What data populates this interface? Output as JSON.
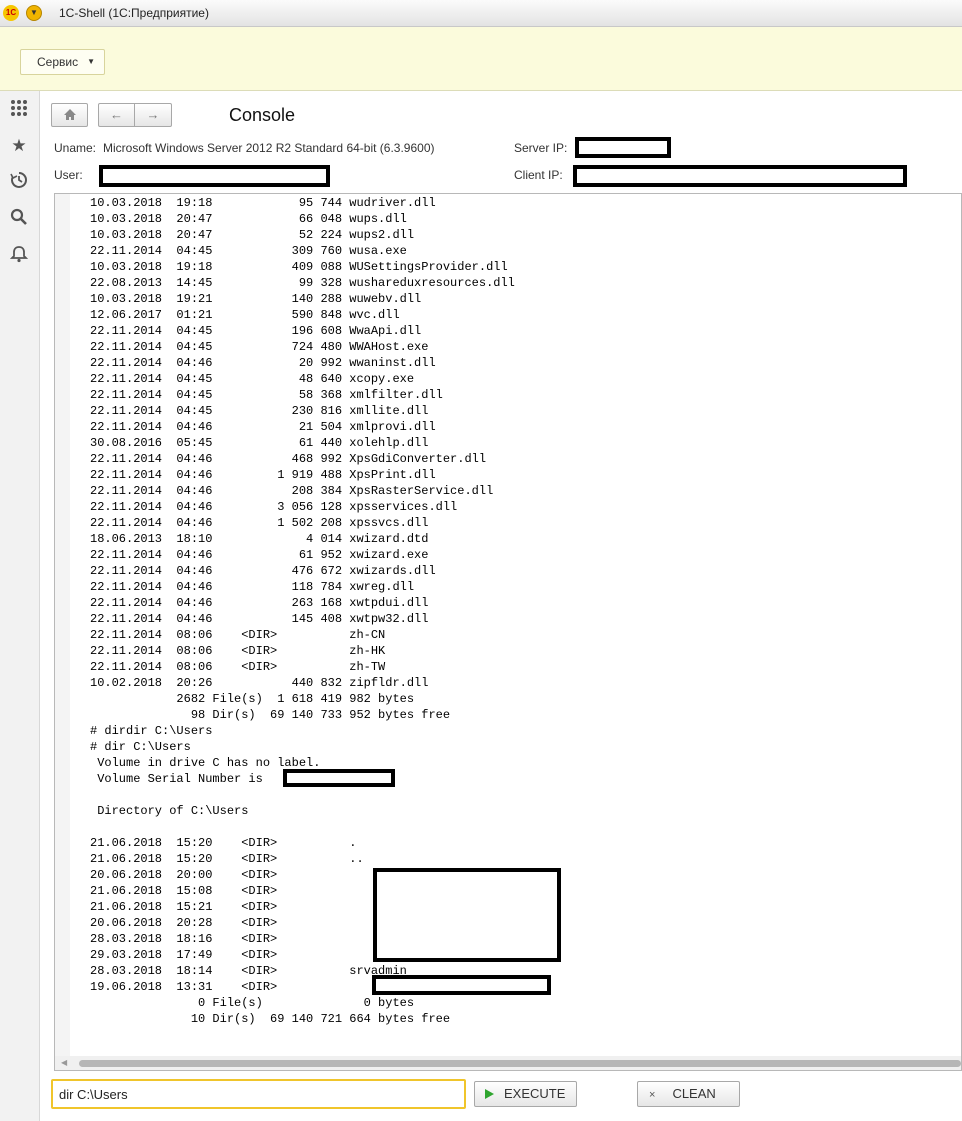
{
  "window": {
    "title": "1C-Shell  (1С:Предприятие)",
    "logo": "1С"
  },
  "section": {
    "service_button": "Сервис"
  },
  "sidebar": {
    "icons": [
      "apps-grid-icon",
      "star-icon",
      "history-icon",
      "search-icon",
      "bell-icon"
    ]
  },
  "header": {
    "title": "Console",
    "uname_label": "Uname:",
    "uname_value": "Microsoft Windows Server 2012 R2 Standard 64-bit (6.3.9600)",
    "user_label": "User:",
    "server_ip_label": "Server IP:",
    "client_ip_label": "Client IP:"
  },
  "console": {
    "lines": [
      "10.03.2018  19:18            95 744 wudriver.dll",
      "10.03.2018  20:47            66 048 wups.dll",
      "10.03.2018  20:47            52 224 wups2.dll",
      "22.11.2014  04:45           309 760 wusa.exe",
      "10.03.2018  19:18           409 088 WUSettingsProvider.dll",
      "22.08.2013  14:45            99 328 wushareduxresources.dll",
      "10.03.2018  19:21           140 288 wuwebv.dll",
      "12.06.2017  01:21           590 848 wvc.dll",
      "22.11.2014  04:45           196 608 WwaApi.dll",
      "22.11.2014  04:45           724 480 WWAHost.exe",
      "22.11.2014  04:46            20 992 wwaninst.dll",
      "22.11.2014  04:45            48 640 xcopy.exe",
      "22.11.2014  04:45            58 368 xmlfilter.dll",
      "22.11.2014  04:45           230 816 xmllite.dll",
      "22.11.2014  04:46            21 504 xmlprovi.dll",
      "30.08.2016  05:45            61 440 xolehlp.dll",
      "22.11.2014  04:46           468 992 XpsGdiConverter.dll",
      "22.11.2014  04:46         1 919 488 XpsPrint.dll",
      "22.11.2014  04:46           208 384 XpsRasterService.dll",
      "22.11.2014  04:46         3 056 128 xpsservices.dll",
      "22.11.2014  04:46         1 502 208 xpssvcs.dll",
      "18.06.2013  18:10             4 014 xwizard.dtd",
      "22.11.2014  04:46            61 952 xwizard.exe",
      "22.11.2014  04:46           476 672 xwizards.dll",
      "22.11.2014  04:46           118 784 xwreg.dll",
      "22.11.2014  04:46           263 168 xwtpdui.dll",
      "22.11.2014  04:46           145 408 xwtpw32.dll",
      "22.11.2014  08:06    <DIR>          zh-CN",
      "22.11.2014  08:06    <DIR>          zh-HK",
      "22.11.2014  08:06    <DIR>          zh-TW",
      "10.02.2018  20:26           440 832 zipfldr.dll",
      "            2682 File(s)  1 618 419 982 bytes",
      "              98 Dir(s)  69 140 733 952 bytes free",
      "# dirdir C:\\Users",
      "# dir C:\\Users",
      " Volume in drive C has no label.",
      " Volume Serial Number is",
      "",
      " Directory of C:\\Users",
      "",
      "21.06.2018  15:20    <DIR>          .",
      "21.06.2018  15:20    <DIR>          ..",
      "20.06.2018  20:00    <DIR>",
      "21.06.2018  15:08    <DIR>",
      "21.06.2018  15:21    <DIR>",
      "20.06.2018  20:28    <DIR>",
      "28.03.2018  18:16    <DIR>",
      "29.03.2018  17:49    <DIR>",
      "28.03.2018  18:14    <DIR>          srvadmin",
      "19.06.2018  13:31    <DIR>",
      "               0 File(s)              0 bytes",
      "              10 Dir(s)  69 140 721 664 bytes free"
    ]
  },
  "command": {
    "value": "dir C:\\Users"
  },
  "buttons": {
    "execute": "EXECUTE",
    "clean": "CLEAN"
  }
}
